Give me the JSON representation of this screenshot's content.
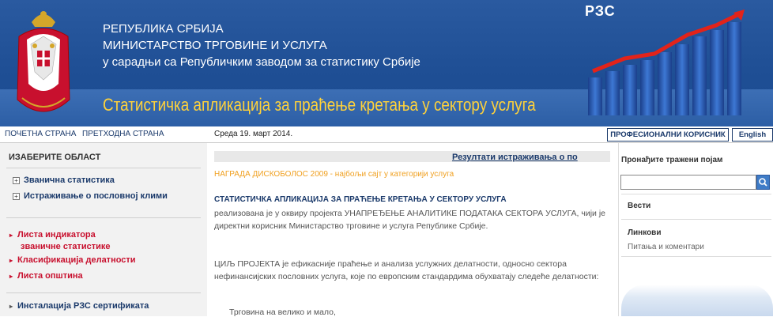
{
  "header": {
    "line1": "РЕПУБЛИКА СРБИЈА",
    "line2": "МИНИСТАРСТВО ТРГОВИНЕ И УСЛУГА",
    "line3": "у сарадњи са Републичким заводом за статистику Србије",
    "app_title": "Статистичка апликација за праћење кретања у сектору услуга",
    "brand": "РЗС"
  },
  "nav": {
    "home": "ПОЧЕТНА СТРАНА",
    "previous": "ПРЕТХОДНА СТРАНА",
    "date": "Среда 19. март 2014.",
    "professional": "ПРОФЕСИОНАЛНИ КОРИСНИК",
    "english": "English"
  },
  "sidebar": {
    "title": "ИЗАБЕРИТЕ ОБЛАСТ",
    "tree": [
      "Званична статистика",
      "Истраживање о пословној клими"
    ],
    "links": [
      "Листа индикатора",
      "званичне статистике",
      "Класификација делатности",
      "Листа општина"
    ],
    "install": "Инсталација РЗС сертификата"
  },
  "main": {
    "results_link": "Резултати истраживања о по",
    "award": "НАГРАДА ДИСКОБОЛОС 2009 - најбољи сајт у категорији услуга",
    "heading": "СТАТИСТИЧКА АПЛИКАЦИЈА ЗА ПРАЋЕЊЕ КРЕТАЊА У СЕКТОРУ УСЛУГА",
    "para1": "реализована је у оквиру пројекта УНАПРЕЂЕЊЕ АНАЛИТИКЕ ПОДАТАКА СЕКТОРА УСЛУГА, чији је директни корисник Министарство трговине и услуга Републике Србије.",
    "para2": "ЦИЉ ПРОЈЕКТА је ефикасније праћење и анализа услужних делатности, односно сектора нефинансијских пословних услуга, које по европским стандардима обухватају следеће делатности:",
    "item1": "Трговина на велико и мало,"
  },
  "right": {
    "search_label": "Пронађите тражени појам",
    "search_value": "",
    "news": "Вести",
    "links": "Линкови",
    "qa": "Питања и коментари"
  },
  "colors": {
    "header_blue": "#1f4f95",
    "title_yellow": "#ffd23a",
    "link_red": "#c8102e",
    "link_blue": "#1b3a6b",
    "award_orange": "#f0a020"
  }
}
